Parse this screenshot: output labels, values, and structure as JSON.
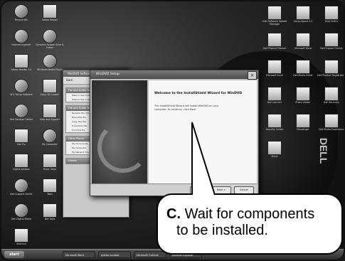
{
  "desktop": {
    "left_icons": [
      {
        "label": "Recycle Bin",
        "shape": "round"
      },
      {
        "label": "Adobe Reader",
        "shape": "doc"
      },
      {
        "label": "Internet Explorer",
        "shape": "round"
      },
      {
        "label": "Dynamic System Scan & Extras",
        "shape": "round"
      },
      {
        "label": "Adobe Reader 7.0",
        "shape": "doc"
      },
      {
        "label": "Windows Media Player",
        "shape": "round"
      },
      {
        "label": "AOL Setup Software",
        "shape": "round"
      },
      {
        "label": "Easy CD Creator",
        "shape": "doc"
      },
      {
        "label": "Dell Solution Center",
        "shape": "round"
      },
      {
        "label": "Help and Support",
        "shape": "doc"
      },
      {
        "label": "Dell Pix",
        "shape": "doc"
      },
      {
        "label": "My Computer",
        "shape": "round"
      },
      {
        "label": "Digital Jukebox",
        "shape": "doc"
      },
      {
        "label": "Music Store",
        "shape": "doc"
      },
      {
        "label": "Dell Support Center",
        "shape": "round"
      },
      {
        "label": "Tools",
        "shape": "doc"
      },
      {
        "label": "Dell Digital Media",
        "shape": "round"
      },
      {
        "label": "Net Tools",
        "shape": "doc"
      },
      {
        "label": "Shortcut",
        "shape": "doc"
      }
    ],
    "right_icons": [
      {
        "label": "Intel Software Update Manager",
        "shape": "doc"
      },
      {
        "label": "Using Alpaca 2.0",
        "shape": "doc"
      },
      {
        "label": "Help Online",
        "shape": "doc"
      },
      {
        "label": "Dell Product Manual",
        "shape": "doc"
      },
      {
        "label": "Microsoft Word",
        "shape": "doc"
      },
      {
        "label": "Dell Support Center",
        "shape": "doc"
      },
      {
        "label": "Microsoft Excel",
        "shape": "doc"
      },
      {
        "label": "Dell Media Direct",
        "shape": "doc"
      },
      {
        "label": "Dell Product Registration",
        "shape": "doc"
      },
      {
        "label": "Dell Connect",
        "shape": "doc"
      },
      {
        "label": "Photo Viewer",
        "shape": "doc"
      },
      {
        "label": "Dell Recovery",
        "shape": "doc"
      },
      {
        "label": "Security Center",
        "shape": "doc"
      },
      {
        "label": "Messenger",
        "shape": "doc"
      },
      {
        "label": "Dell Media Experience",
        "shape": "doc"
      },
      {
        "label": "Music",
        "shape": "doc"
      }
    ],
    "brand": "DELL"
  },
  "explorer": {
    "title": "WinDVD Software",
    "toolbar": "Back",
    "panels": [
      {
        "header": "File and Folder Tasks",
        "rows": [
          "Make a new folder",
          "Publish this folder"
        ]
      },
      {
        "header": "File and Folder Tasks",
        "rows": [
          "Rename this file",
          "Move this file",
          "Copy this file",
          "E-mail this file",
          "Print this file"
        ]
      },
      {
        "header": "Other Places",
        "rows": [
          "My Documents",
          "My Computer",
          "My Network Places"
        ]
      },
      {
        "header": "Details",
        "rows": []
      }
    ]
  },
  "wizard": {
    "title": "WinDVD Setup",
    "heading": "Welcome to the InstallShield Wizard for WinDVD",
    "body": "The InstallShield Wizard will install WinDVD on your computer. To continue, click Next.",
    "buttons": {
      "back": "< Back",
      "next": "Next >",
      "cancel": "Cancel"
    }
  },
  "taskbar": {
    "start_label": "start",
    "items": [
      "Microsoft Word",
      "Adobe Acrobat",
      "Microsoft Outlook",
      "Internet Explorer"
    ]
  },
  "callout": {
    "step": "C.",
    "line1": "Wait for components",
    "line2": "to be installed."
  }
}
